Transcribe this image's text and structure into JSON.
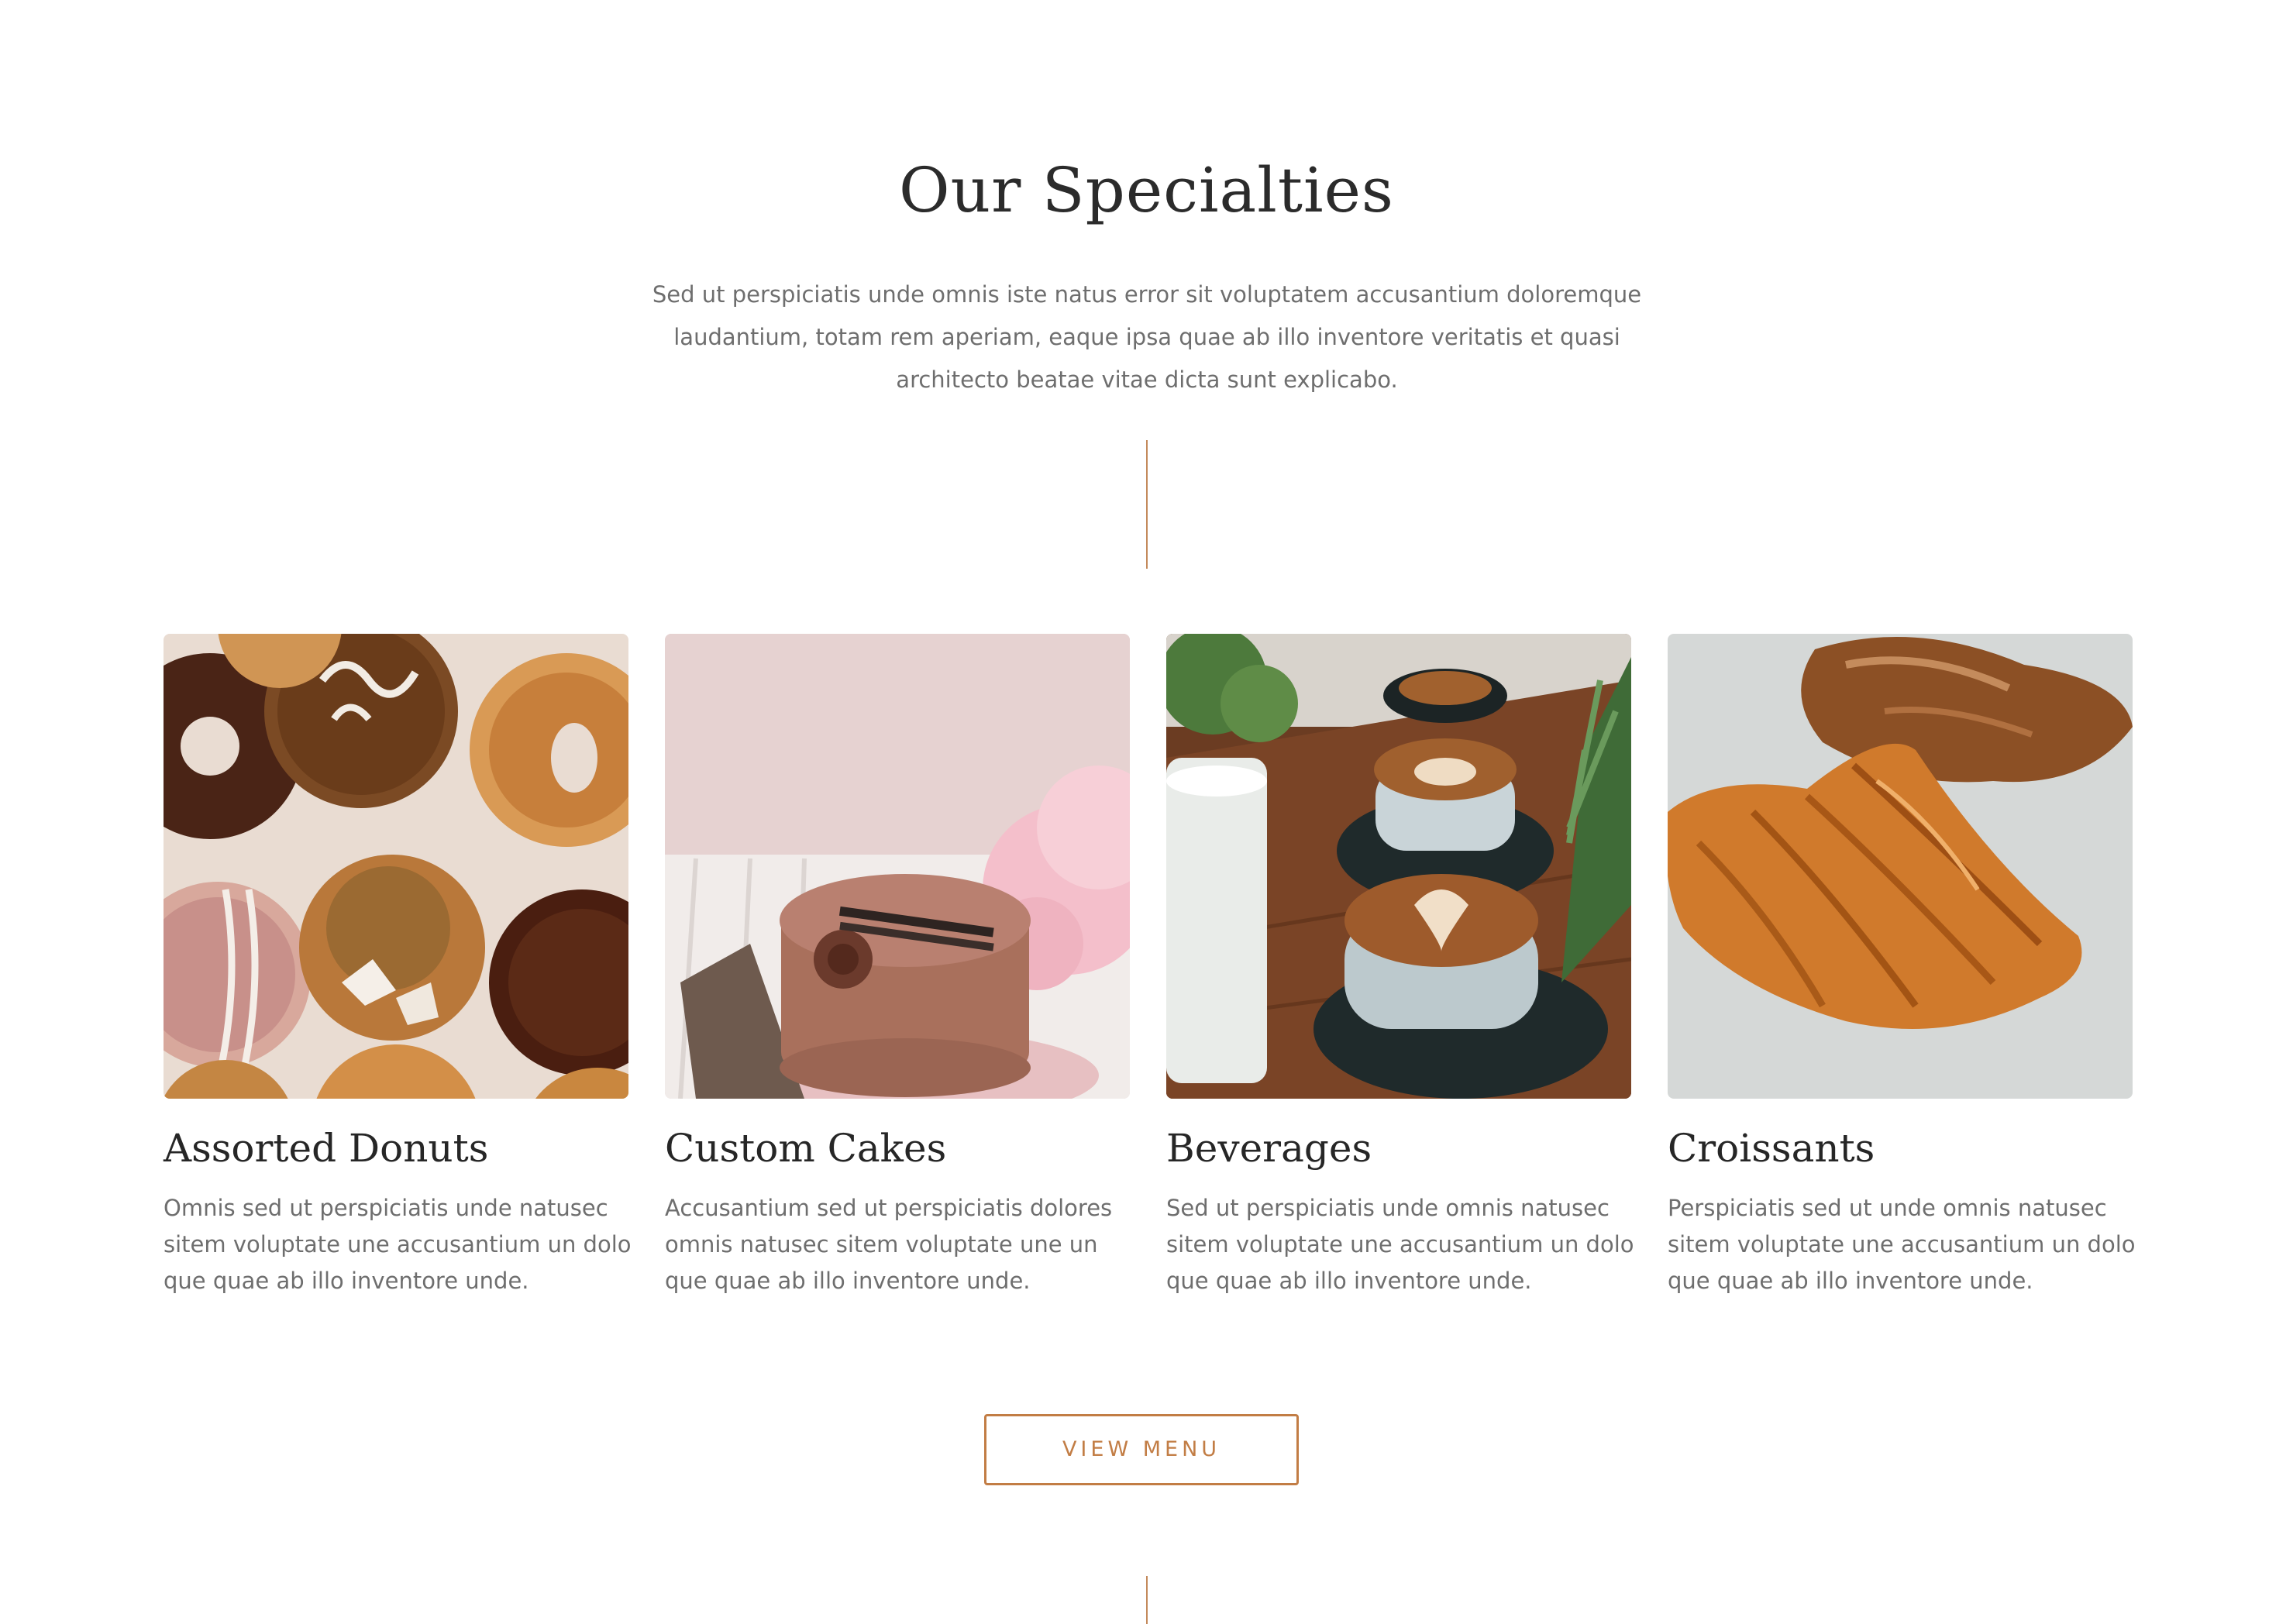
{
  "section": {
    "title": "Our Specialties",
    "intro": "Sed ut perspiciatis unde omnis iste natus error sit voluptatem accusantium doloremque laudantium, totam rem aperiam, eaque ipsa quae ab illo inventore veritatis et quasi architecto beatae vitae dicta sunt explicabo."
  },
  "cards": [
    {
      "title": "Assorted Donuts",
      "text": "Omnis sed ut perspiciatis unde natusec sitem voluptate une accusantium un dolo que quae ab illo inventore unde.",
      "image": "donuts-photo"
    },
    {
      "title": "Custom Cakes",
      "text": "Accusantium sed ut perspiciatis dolores omnis natusec sitem voluptate une un que quae ab illo inventore unde.",
      "image": "chocolate-cake-photo"
    },
    {
      "title": "Beverages",
      "text": "Sed ut perspiciatis unde omnis natusec sitem voluptate une accusantium un dolo que quae ab illo inventore unde.",
      "image": "latte-cups-photo"
    },
    {
      "title": "Croissants",
      "text": "Perspiciatis sed ut unde omnis natusec sitem voluptate une accusantium un dolo que quae ab illo inventore unde.",
      "image": "croissant-photo"
    }
  ],
  "cta": {
    "label": "VIEW MENU"
  },
  "colors": {
    "accent": "#c27d45",
    "heading": "#2b2b2b",
    "body_text": "#6e6e6e",
    "divider": "#c48a5c"
  }
}
